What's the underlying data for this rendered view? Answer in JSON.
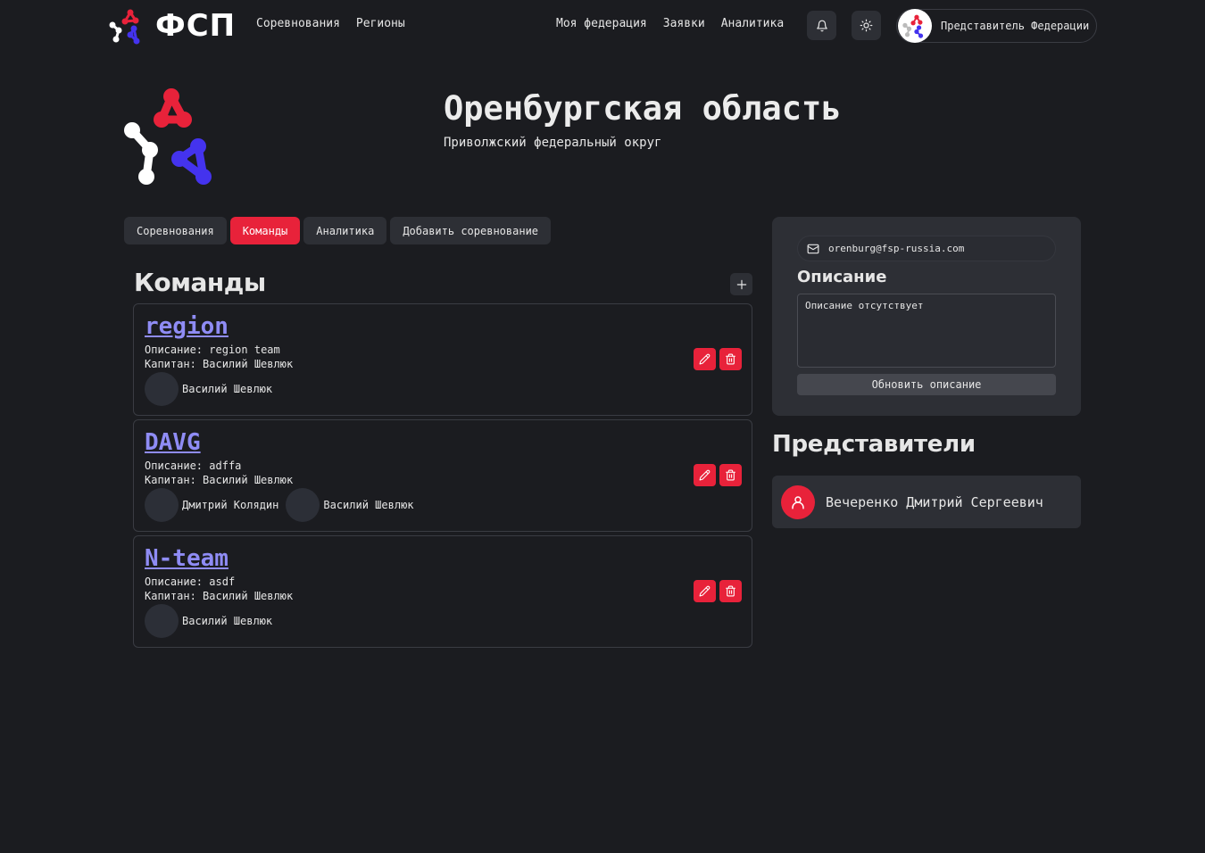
{
  "header": {
    "brand": "ФСП",
    "nav_left": [
      "Соревнования",
      "Регионы"
    ],
    "nav_right": [
      "Моя федерация",
      "Заявки",
      "Аналитика"
    ],
    "notifications_icon": "bell-icon",
    "theme_icon": "sun-icon",
    "user_label": "Представитель Федерации"
  },
  "region": {
    "title": "Оренбургская область",
    "district": "Приволжский федеральный округ"
  },
  "tabs": [
    {
      "label": "Соревнования",
      "active": false
    },
    {
      "label": "Команды",
      "active": true
    },
    {
      "label": "Аналитика",
      "active": false
    },
    {
      "label": "Добавить соревнование",
      "active": false
    }
  ],
  "teams_section": {
    "heading": "Команды",
    "description_prefix": "Описание:",
    "captain_prefix": "Капитан:",
    "teams": [
      {
        "name": "region",
        "description": "region team",
        "captain": "Василий Шевлюк",
        "members": [
          "Василий Шевлюк"
        ]
      },
      {
        "name": "DAVG",
        "description": "adffa",
        "captain": "Василий Шевлюк",
        "members": [
          "Дмитрий Колядин",
          "Василий Шевлюк"
        ]
      },
      {
        "name": "N-team",
        "description": "asdf",
        "captain": "Василий Шевлюк",
        "members": [
          "Василий Шевлюк"
        ]
      }
    ]
  },
  "info_panel": {
    "email": "orenburg@fsp-russia.com",
    "description_heading": "Описание",
    "description_placeholder": "Описание отсутствует",
    "update_button": "Обновить описание"
  },
  "representatives": {
    "heading": "Представители",
    "items": [
      {
        "name": "Вечеренко Дмитрий Сергеевич"
      }
    ]
  },
  "colors": {
    "accent": "#e8223a",
    "link": "#8f8cf5",
    "logo_blue": "#4433ee",
    "background": "#1b1c20",
    "surface": "#2d2f35"
  }
}
